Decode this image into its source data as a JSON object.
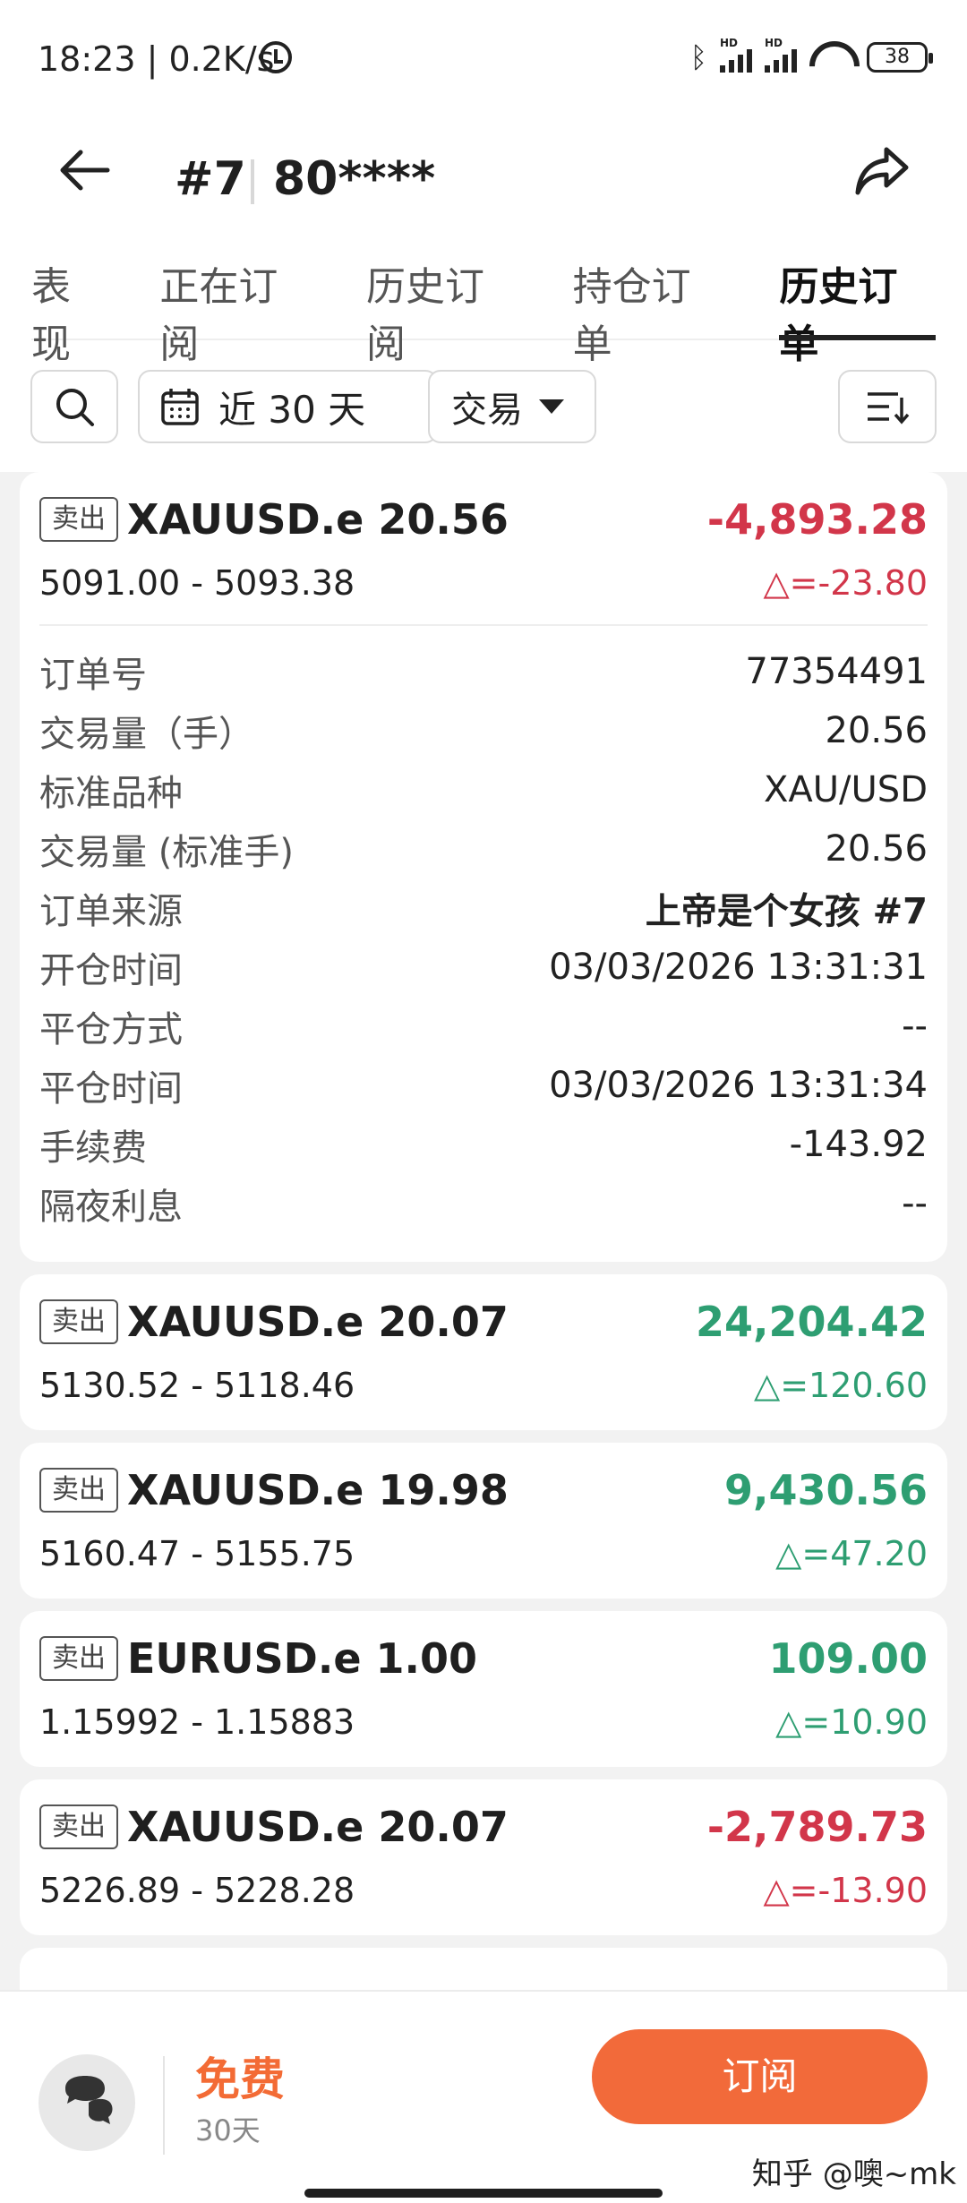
{
  "status_bar": {
    "time": "18:23 | 0.2K/s",
    "battery": "38"
  },
  "header": {
    "account_id": "#7",
    "account_number": "80****"
  },
  "tabs": [
    {
      "label": "表现"
    },
    {
      "label": "正在订阅"
    },
    {
      "label": "历史订阅"
    },
    {
      "label": "持仓订单"
    },
    {
      "label": "历史订单",
      "active": true
    }
  ],
  "filters": {
    "date_range": "近 30 天",
    "type": "交易"
  },
  "orders": [
    {
      "side": "卖出",
      "symbol": "XAUUSD.e 20.56",
      "pnl": "-4,893.28",
      "prices": "5091.00 - 5093.38",
      "delta": "△=-23.80",
      "direction": "negative",
      "expanded": true,
      "details": [
        {
          "label": "订单号",
          "value": "77354491"
        },
        {
          "label": "交易量（手）",
          "value": "20.56"
        },
        {
          "label": "标准品种",
          "value": "XAU/USD"
        },
        {
          "label": "交易量 (标准手)",
          "value": "20.56"
        },
        {
          "label": "订单来源",
          "value": "上帝是个女孩 #7"
        },
        {
          "label": "开仓时间",
          "value": "03/03/2026 13:31:31"
        },
        {
          "label": "平仓方式",
          "value": "--"
        },
        {
          "label": "平仓时间",
          "value": "03/03/2026 13:31:34"
        },
        {
          "label": "手续费",
          "value": "-143.92"
        },
        {
          "label": "隔夜利息",
          "value": "--"
        }
      ]
    },
    {
      "side": "卖出",
      "symbol": "XAUUSD.e 20.07",
      "pnl": "24,204.42",
      "prices": "5130.52 - 5118.46",
      "delta": "△=120.60",
      "direction": "positive"
    },
    {
      "side": "卖出",
      "symbol": "XAUUSD.e 19.98",
      "pnl": "9,430.56",
      "prices": "5160.47 - 5155.75",
      "delta": "△=47.20",
      "direction": "positive"
    },
    {
      "side": "卖出",
      "symbol": "EURUSD.e 1.00",
      "pnl": "109.00",
      "prices": "1.15992 - 1.15883",
      "delta": "△=10.90",
      "direction": "positive"
    },
    {
      "side": "卖出",
      "symbol": "XAUUSD.e 20.07",
      "pnl": "-2,789.73",
      "prices": "5226.89 - 5228.28",
      "delta": "△=-13.90",
      "direction": "negative"
    }
  ],
  "bottom_bar": {
    "price": "免费",
    "period": "30天",
    "subscribe_label": "订阅",
    "watermark": "知乎 @噢~mk"
  },
  "colors": {
    "negative": "#d2364a",
    "positive": "#2e9e72",
    "accent": "#f26a3a"
  }
}
